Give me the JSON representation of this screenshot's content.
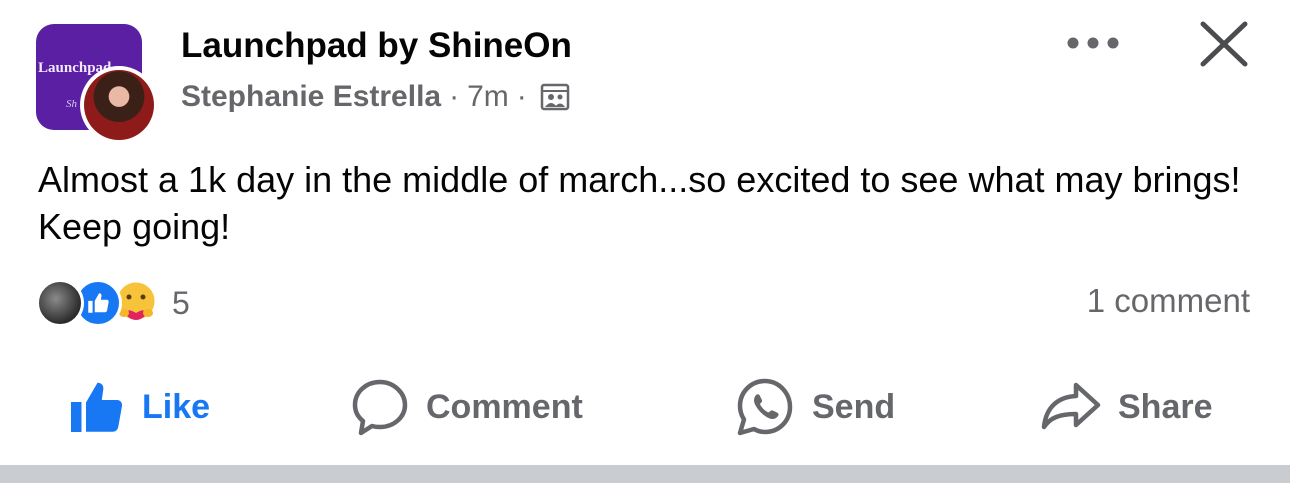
{
  "header": {
    "group_name": "Launchpad by ShineOn",
    "group_avatar_text": "Launchpad",
    "group_avatar_subtext": "Sh",
    "author": "Stephanie Estrella",
    "time": "7m",
    "separator": "·",
    "audience_icon": "group-audience-icon",
    "more_icon": "more-dots-icon",
    "close_icon": "close-icon"
  },
  "post": {
    "text": "Almost a 1k day in the middle of march...so excited to see what may brings! Keep going!"
  },
  "reactions": {
    "count": "5",
    "comments": "1 comment",
    "types": [
      "avatar",
      "like-reaction",
      "care-reaction"
    ]
  },
  "actions": {
    "like": "Like",
    "comment": "Comment",
    "send": "Send",
    "share": "Share"
  },
  "colors": {
    "accent": "#1877f2",
    "secondary_text": "#65676b",
    "primary_text": "#050505",
    "group_avatar_bg": "#5a1fa3"
  }
}
